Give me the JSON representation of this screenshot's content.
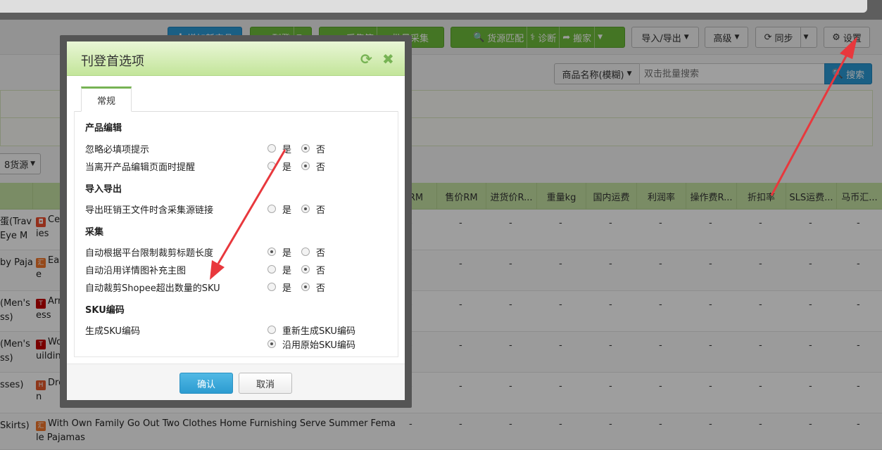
{
  "toolbar": {
    "add_product": "增加新产品",
    "publish": "刊登",
    "collect_box": "采集箱",
    "batch_collect": "批量采集",
    "source_match": "货源匹配",
    "diagnose": "诊断",
    "move": "搬家",
    "import_export": "导入/导出",
    "advanced": "高级",
    "sync": "同步",
    "settings": "设置"
  },
  "search": {
    "field_select": "商品名称(模糊)",
    "placeholder": "双击批量搜索",
    "button": "搜索"
  },
  "source_filter": "8货源",
  "table": {
    "columns": [
      "价RM",
      "售价RM",
      "进货价R...",
      "重量kg",
      "国内运费",
      "利润率",
      "操作费R...",
      "折扣率",
      "SLS运费...",
      "马币汇..."
    ],
    "dash": "-",
    "rows": [
      {
        "name_lines": [
          "蛋(Trav",
          " Eye M"
        ],
        "title_lines": [
          "Cere",
          "ies"
        ],
        "platform": "shopee"
      },
      {
        "name_lines": [
          "by Paja",
          ""
        ],
        "title_lines": [
          "Easy",
          "e"
        ],
        "platform": "1688"
      },
      {
        "name_lines": [
          "(Men's",
          "ss)"
        ],
        "title_lines": [
          "Arms",
          "ess"
        ],
        "platform": "tmall"
      },
      {
        "name_lines": [
          "(Men's",
          "ss)"
        ],
        "title_lines": [
          "Won",
          "uilding"
        ],
        "platform": "tmall"
      },
      {
        "name_lines": [
          "sses)",
          ""
        ],
        "title_lines": [
          "Dres",
          "n"
        ],
        "platform": "h"
      },
      {
        "name_lines": [
          " Skirts)",
          ""
        ],
        "title_lines": [
          "With Own Family Go Out Two Clothes Home Furnishing Serve Summer Fema",
          "le Pajamas"
        ],
        "platform": "1688"
      }
    ]
  },
  "modal": {
    "title": "刊登首选项",
    "tab_general": "常规",
    "yes": "是",
    "no": "否",
    "sections": {
      "product_edit": "产品编辑",
      "import_export": "导入导出",
      "collect": "采集",
      "sku_code": "SKU编码"
    },
    "options": {
      "ignore_required": "忽略必填项提示",
      "leave_page_remind": "当离开产品编辑页面时提醒",
      "export_include_link": "导出旺销王文件时含采集源链接",
      "auto_trim_title": "自动根据平台限制裁剪标题长度",
      "auto_detail_images": "自动沿用详情图补充主图",
      "auto_trim_sku": "自动裁剪Shopee超出数量的SKU",
      "generate_sku": "生成SKU编码",
      "regenerate_sku": "重新生成SKU编码",
      "keep_original_sku": "沿用原始SKU编码"
    },
    "ok": "确认",
    "cancel": "取消"
  },
  "colors": {
    "accent_green": "#77b354",
    "primary_blue": "#2a9ad6",
    "annotation_red": "#e8383d"
  }
}
